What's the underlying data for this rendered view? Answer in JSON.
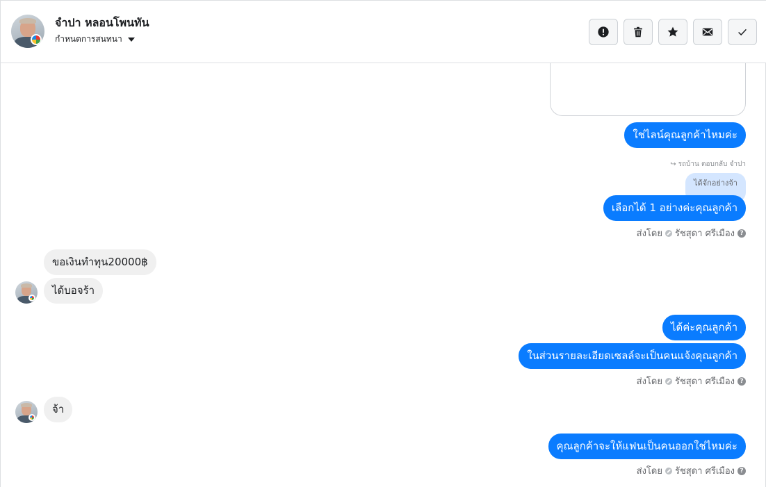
{
  "header": {
    "contact_name": "จำปา หลอนโพนทัน",
    "status_label": "กำหนดการสนทนา",
    "actions": [
      {
        "name": "report-button",
        "icon": "exclamation-circle-icon"
      },
      {
        "name": "delete-button",
        "icon": "trash-icon"
      },
      {
        "name": "star-button",
        "icon": "star-icon"
      },
      {
        "name": "mark-unread-button",
        "icon": "envelope-icon"
      },
      {
        "name": "done-button",
        "icon": "check-icon"
      }
    ]
  },
  "messages": {
    "m1": "ใช่ไลน์คุณลูกค้าไหมค่ะ",
    "reply_label": "รถบ้าน ตอบกลับ จำปา",
    "reply_quote": "ได้จักอย่างจ้า",
    "m2": "เลือกได้ 1 อย่างค่ะคุณลูกค้า",
    "sent_by_1": "ส่งโดย",
    "agent_1": "รัชสุดา ศรีเมือง",
    "in1": "ขอเงินทำทุน20000฿",
    "in2": "ได้บอจร้า",
    "m3": "ได้ค่ะคุณลูกค้า",
    "m4": "ในส่วนรายละเอียดเซลล์จะเป็นคนแจ้งคุณลูกค้า",
    "sent_by_2": "ส่งโดย",
    "agent_2": "รัชสุดา ศรีเมือง",
    "in3": "จ้า",
    "m5": "คุณลูกค้าจะให้แฟนเป็นคนออกใช่ไหมค่ะ",
    "sent_by_3": "ส่งโดย",
    "agent_3": "รัชสุดา ศรีเมือง"
  },
  "colors": {
    "outgoing_bubble": "#0a7cff",
    "incoming_bubble": "#f0f0f0",
    "reply_quote_bg": "#d4e6ff"
  }
}
